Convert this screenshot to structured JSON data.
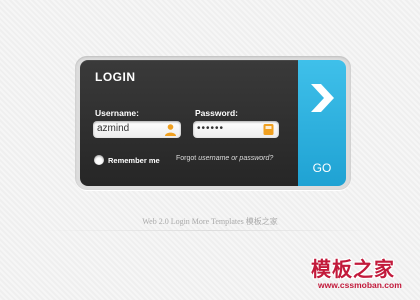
{
  "login": {
    "title": "LOGIN",
    "username_label": "Username:",
    "username_value": "azmind",
    "password_label": "Password:",
    "password_value": "••••••",
    "remember_label": "Remember me",
    "forgot_prefix": "Forgot ",
    "forgot_link": "username or password?",
    "go_label": "GO",
    "icons": {
      "username": "user-icon",
      "password": "lock-icon",
      "go": "chevron-right-icon"
    }
  },
  "footer": {
    "text": "Web 2.0 Login More Templates 模板之家"
  },
  "watermark": {
    "cn": "模板之家",
    "url": "www.cssmoban.com"
  },
  "colors": {
    "accent": "#29b3e3",
    "panel": "#2e2e2e",
    "icon_orange": "#f0a020",
    "watermark": "#c21a3b"
  }
}
